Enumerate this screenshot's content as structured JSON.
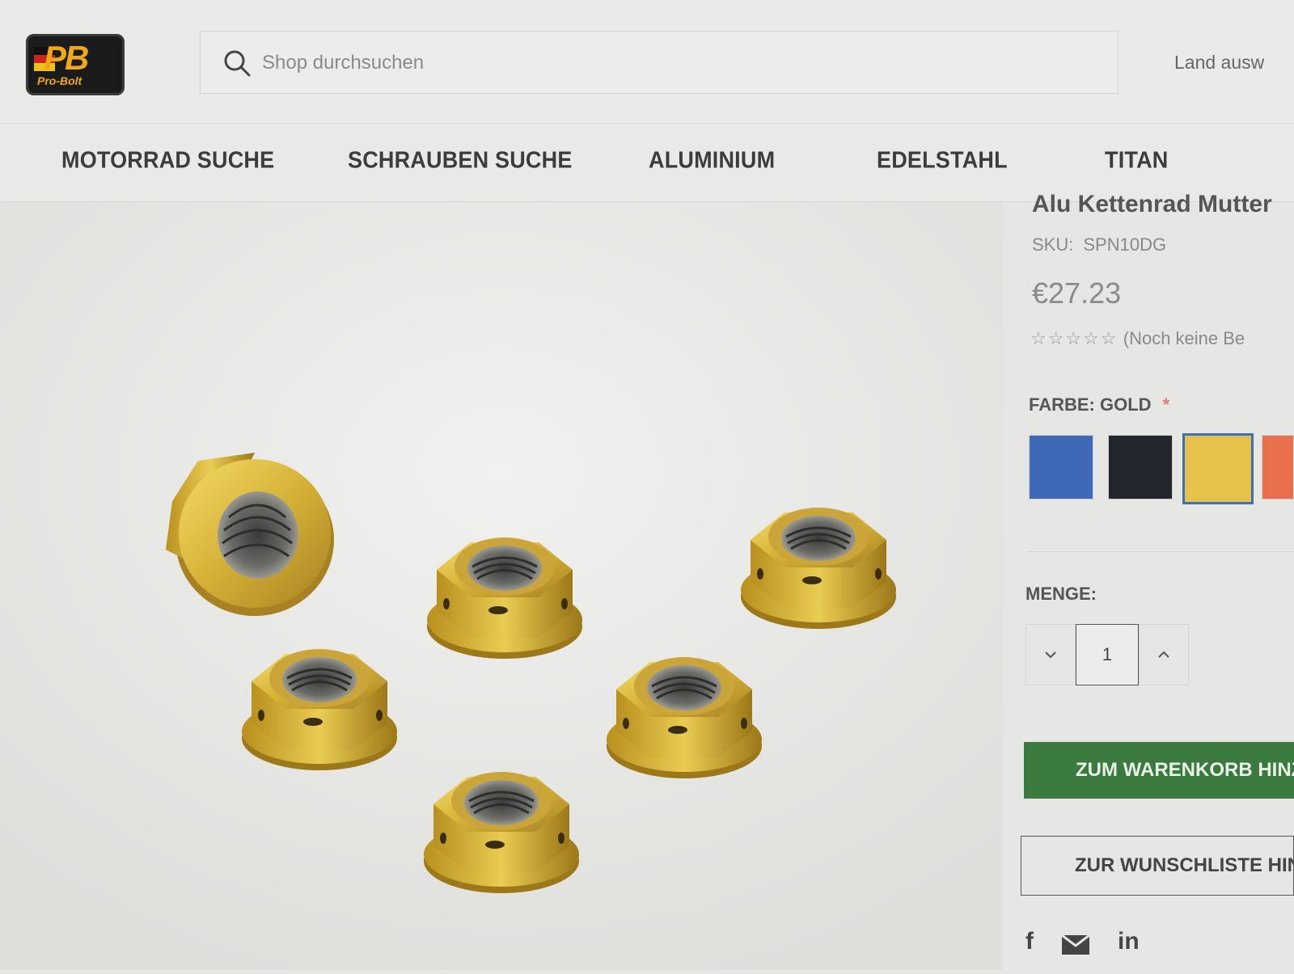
{
  "header": {
    "logo": {
      "text": "PB",
      "subtext": "Pro-Bolt"
    },
    "search": {
      "placeholder": "Shop durchsuchen"
    },
    "country_label": "Land ausw"
  },
  "nav": {
    "items": [
      "MOTORRAD SUCHE",
      "SCHRAUBEN SUCHE",
      "ALUMINIUM",
      "EDELSTAHL",
      "TITAN"
    ]
  },
  "product": {
    "title": "Alu Kettenrad Mutter",
    "sku_label": "SKU:",
    "sku": "SPN10DG",
    "price": "€27.23",
    "stars": "☆☆☆☆☆",
    "rating_text": "(Noch keine Be",
    "color_label": "FARBE: GOLD",
    "required_mark": "*",
    "swatches": [
      {
        "color": "#3f68b6",
        "name": "blue"
      },
      {
        "color": "#24262e",
        "name": "black"
      },
      {
        "color": "#e6c24a",
        "name": "gold",
        "selected": true
      },
      {
        "color": "#e8704c",
        "name": "orange"
      }
    ],
    "quantity_label": "MENGE:",
    "quantity": "1",
    "decrement_icon": "chevron-down-icon",
    "increment_icon": "chevron-up-icon",
    "cart_button": "ZUM WARENKORB HINZ",
    "wishlist_button": "ZUR WUNSCHLISTE HIN",
    "share_icons": [
      "facebook-icon",
      "email-icon",
      "linkedin-icon"
    ]
  },
  "colors": {
    "accent_green": "#3b7a3f",
    "selected_border": "#3e6fbd"
  }
}
